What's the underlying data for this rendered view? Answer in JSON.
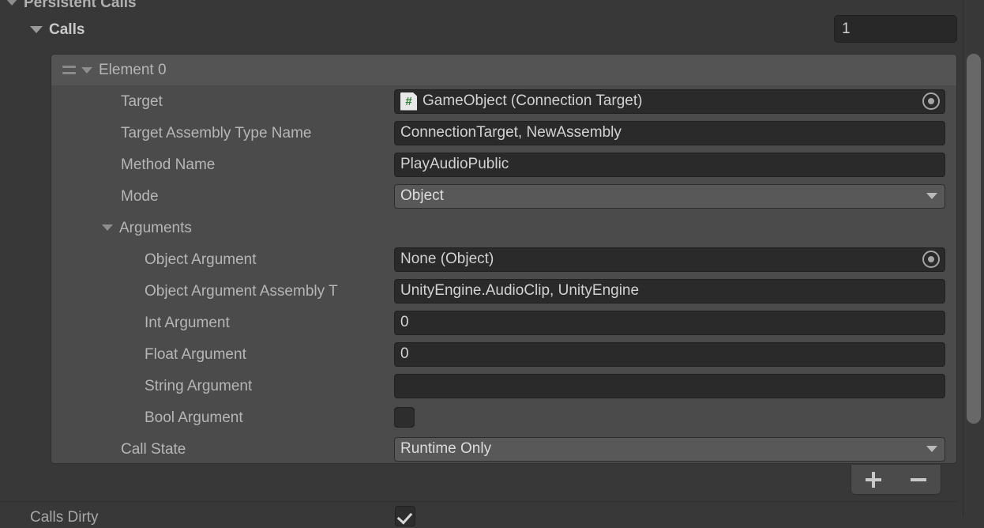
{
  "header": {
    "persistent_calls_label": "Persistent Calls",
    "calls_label": "Calls",
    "size_value": "1"
  },
  "element": {
    "title": "Element 0",
    "drag_handle_icon": "drag-handle-icon",
    "foldout_icon": "foldout-triangle-icon"
  },
  "fields": {
    "target": {
      "label": "Target",
      "value": "GameObject (Connection Target)",
      "icon": "gameobject-icon",
      "icon_glyph": "#",
      "picker_icon": "object-picker-icon"
    },
    "target_assembly_type_name": {
      "label": "Target Assembly Type Name",
      "value": "ConnectionTarget, NewAssembly"
    },
    "method_name": {
      "label": "Method Name",
      "value": "PlayAudioPublic"
    },
    "mode": {
      "label": "Mode",
      "value": "Object",
      "dropdown_icon": "chevron-down-icon"
    },
    "arguments_label": "Arguments",
    "object_argument": {
      "label": "Object Argument",
      "value": "None (Object)",
      "picker_icon": "object-picker-icon"
    },
    "object_argument_assembly_type_name": {
      "label": "Object Argument Assembly T",
      "value": "UnityEngine.AudioClip, UnityEngine"
    },
    "int_argument": {
      "label": "Int Argument",
      "value": "0"
    },
    "float_argument": {
      "label": "Float Argument",
      "value": "0"
    },
    "string_argument": {
      "label": "String Argument",
      "value": ""
    },
    "bool_argument": {
      "label": "Bool Argument",
      "checked": false
    },
    "call_state": {
      "label": "Call State",
      "value": "Runtime Only",
      "dropdown_icon": "chevron-down-icon"
    }
  },
  "footer": {
    "add_label": "+",
    "remove_label": "−"
  },
  "bottom": {
    "calls_dirty_label": "Calls Dirty",
    "calls_dirty_checked": true
  },
  "colors": {
    "window_bg": "#383838",
    "list_bg": "#4b4b4b",
    "element_header_bg": "#545454",
    "field_bg": "#2a2a2a",
    "popup_bg": "#585858",
    "text": "#c4c4c4",
    "icon_green": "#2f7d32"
  }
}
